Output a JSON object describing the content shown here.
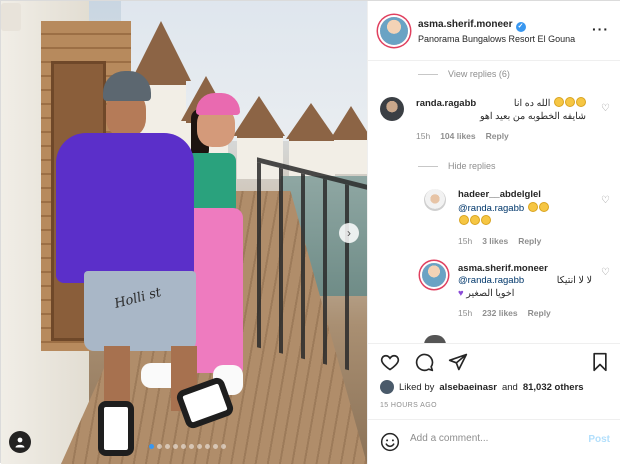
{
  "post": {
    "username": "asma.sherif.moneer",
    "location": "Panorama Bungalows Resort El Gouna",
    "photo_text": "Holli st",
    "carousel": {
      "count": 10,
      "active_index": 0
    }
  },
  "comments": {
    "view_replies_label": "View replies (6)",
    "hide_replies_label": "Hide replies",
    "items": [
      {
        "username": "randa.ragabb",
        "text_line1": "الله ده انا",
        "text_line2": "شايفه الخطوبه من بعيد اهو",
        "time": "15h",
        "likes": "104 likes",
        "reply": "Reply"
      },
      {
        "username": "hadeer__abdelglel",
        "mention": "@randa.ragabb",
        "time": "15h",
        "likes": "3 likes",
        "reply": "Reply"
      },
      {
        "username": "asma.sherif.moneer",
        "mention": "@randa.ragabb",
        "text_line1": "لا لا انتيكا",
        "text_line2": "اخويا الصغير",
        "time": "15h",
        "likes": "232 likes",
        "reply": "Reply"
      }
    ]
  },
  "likes": {
    "prefix": "Liked by",
    "user": "alsebaeinasr",
    "middle": "and",
    "others": "81,032 others"
  },
  "timestamp": "15 HOURS AGO",
  "add_comment": {
    "placeholder": "Add a comment...",
    "post_label": "Post"
  },
  "icons": {
    "more": "more-horizontal-icon",
    "heart": "heart-icon",
    "comment": "comment-icon",
    "share": "share-icon",
    "save": "bookmark-icon",
    "emoji": "emoji-smile-icon",
    "next": "chevron-right-icon",
    "user_tag": "user-tag-icon",
    "verified": "verified-badge-icon"
  },
  "colors": {
    "accent": "#3897f0",
    "link": "#00376b",
    "muted": "#8e8e8e",
    "post_disabled": "#b2dffc"
  }
}
